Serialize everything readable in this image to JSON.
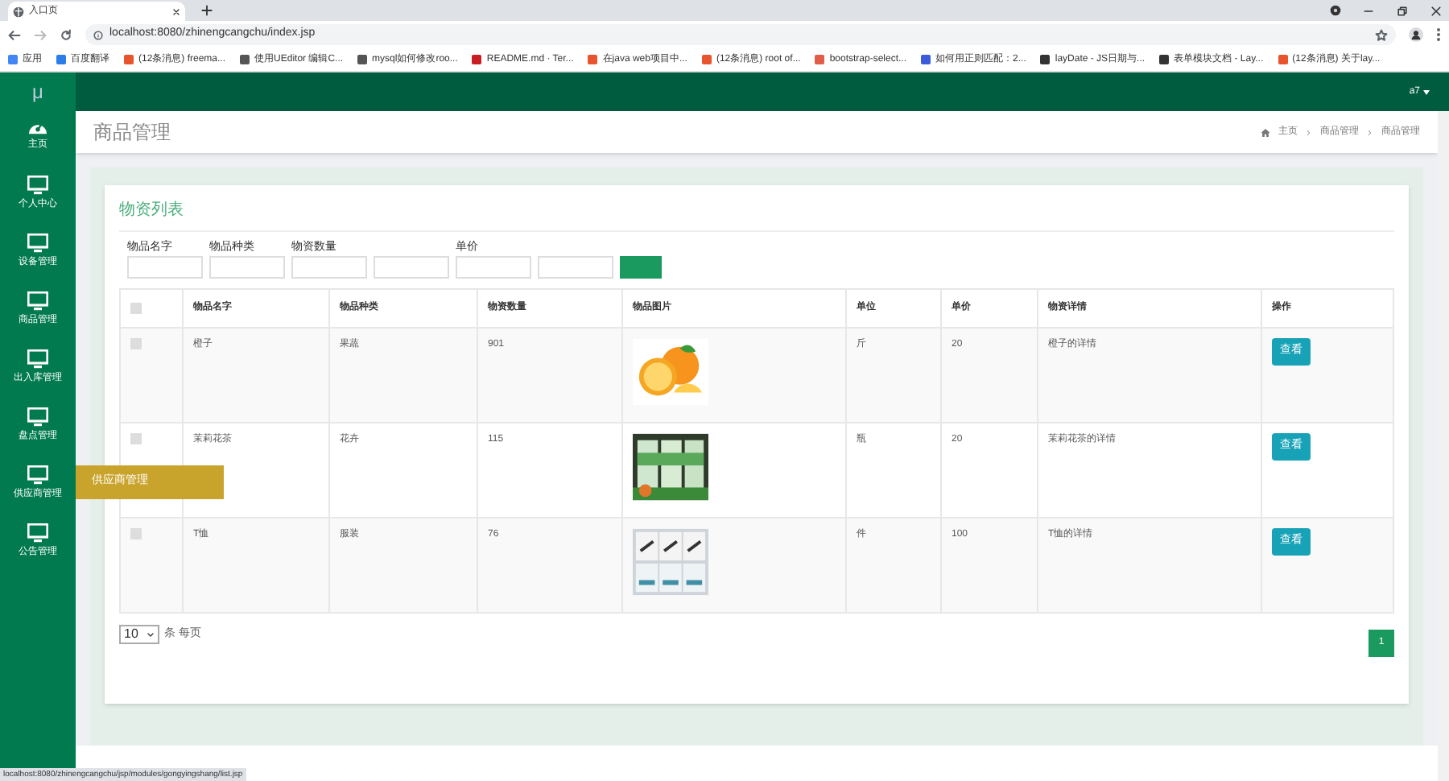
{
  "browser": {
    "tab": {
      "title": "入口页"
    },
    "url": "localhost:8080/zhinengcangchu/index.jsp",
    "bookmarks": [
      {
        "label": "应用",
        "color": "#4285f4"
      },
      {
        "label": "百度翻译",
        "color": "#2b7de9"
      },
      {
        "label": "(12条消息) freema...",
        "color": "#e8542d"
      },
      {
        "label": "使用UEditor 编辑C...",
        "color": "#555555"
      },
      {
        "label": "mysql如何修改roo...",
        "color": "#555555"
      },
      {
        "label": "README.md · Ter...",
        "color": "#c71d23"
      },
      {
        "label": "在java web项目中...",
        "color": "#e8542d"
      },
      {
        "label": "(12条消息) root of...",
        "color": "#e8542d"
      },
      {
        "label": "bootstrap-select...",
        "color": "#e25c4a"
      },
      {
        "label": "如何用正则匹配：2...",
        "color": "#3b5bdb"
      },
      {
        "label": "layDate - JS日期与...",
        "color": "#333333"
      },
      {
        "label": "表单模块文档 - Lay...",
        "color": "#333333"
      },
      {
        "label": "(12条消息) 关于lay...",
        "color": "#e8542d"
      }
    ],
    "status_url": "localhost:8080/zhinengcangchu/jsp/modules/gongyingshang/list.jsp"
  },
  "app": {
    "logo": "μ",
    "user": "a7"
  },
  "sidebar": {
    "items": [
      {
        "label": "主页",
        "kind": "home"
      },
      {
        "label": "个人中心",
        "kind": "monitor"
      },
      {
        "label": "设备管理",
        "kind": "monitor"
      },
      {
        "label": "商品管理",
        "kind": "monitor"
      },
      {
        "label": "出入库管理",
        "kind": "monitor"
      },
      {
        "label": "盘点管理",
        "kind": "monitor"
      },
      {
        "label": "供应商管理",
        "kind": "monitor"
      },
      {
        "label": "公告管理",
        "kind": "monitor"
      }
    ],
    "tooltip": {
      "label": "供应商管理"
    }
  },
  "page": {
    "title": "商品管理",
    "breadcrumb": [
      "主页",
      "商品管理",
      "商品管理"
    ]
  },
  "card": {
    "title": "物资列表",
    "filters": [
      {
        "label": "物品名字",
        "kind": "single"
      },
      {
        "label": "物品种类",
        "kind": "single"
      },
      {
        "label": "物资数量",
        "kind": "range"
      },
      {
        "label": "单价",
        "kind": "range"
      }
    ],
    "select_all": {
      "checked": false
    },
    "table": {
      "columns": [
        "物品名字",
        "物品种类",
        "物资数量",
        "物品图片",
        "单位",
        "单价",
        "物资详情",
        "操作"
      ],
      "rows": [
        {
          "checked": false,
          "name": "橙子",
          "type": "果蔬",
          "quantity": "901",
          "unit": "斤",
          "price": "20",
          "detail": "橙子的详情",
          "action": "查看"
        },
        {
          "checked": false,
          "name": "茉莉花茶",
          "type": "花卉",
          "quantity": "115",
          "unit": "瓶",
          "price": "20",
          "detail": "茉莉花茶的详情",
          "action": "查看"
        },
        {
          "checked": false,
          "name": "T恤",
          "type": "服装",
          "quantity": "76",
          "unit": "件",
          "price": "100",
          "detail": "T恤的详情",
          "action": "查看"
        }
      ]
    },
    "page_size": "10",
    "page_size_label": "条 每页",
    "pages": [
      {
        "label": "1",
        "selected": true
      }
    ]
  }
}
